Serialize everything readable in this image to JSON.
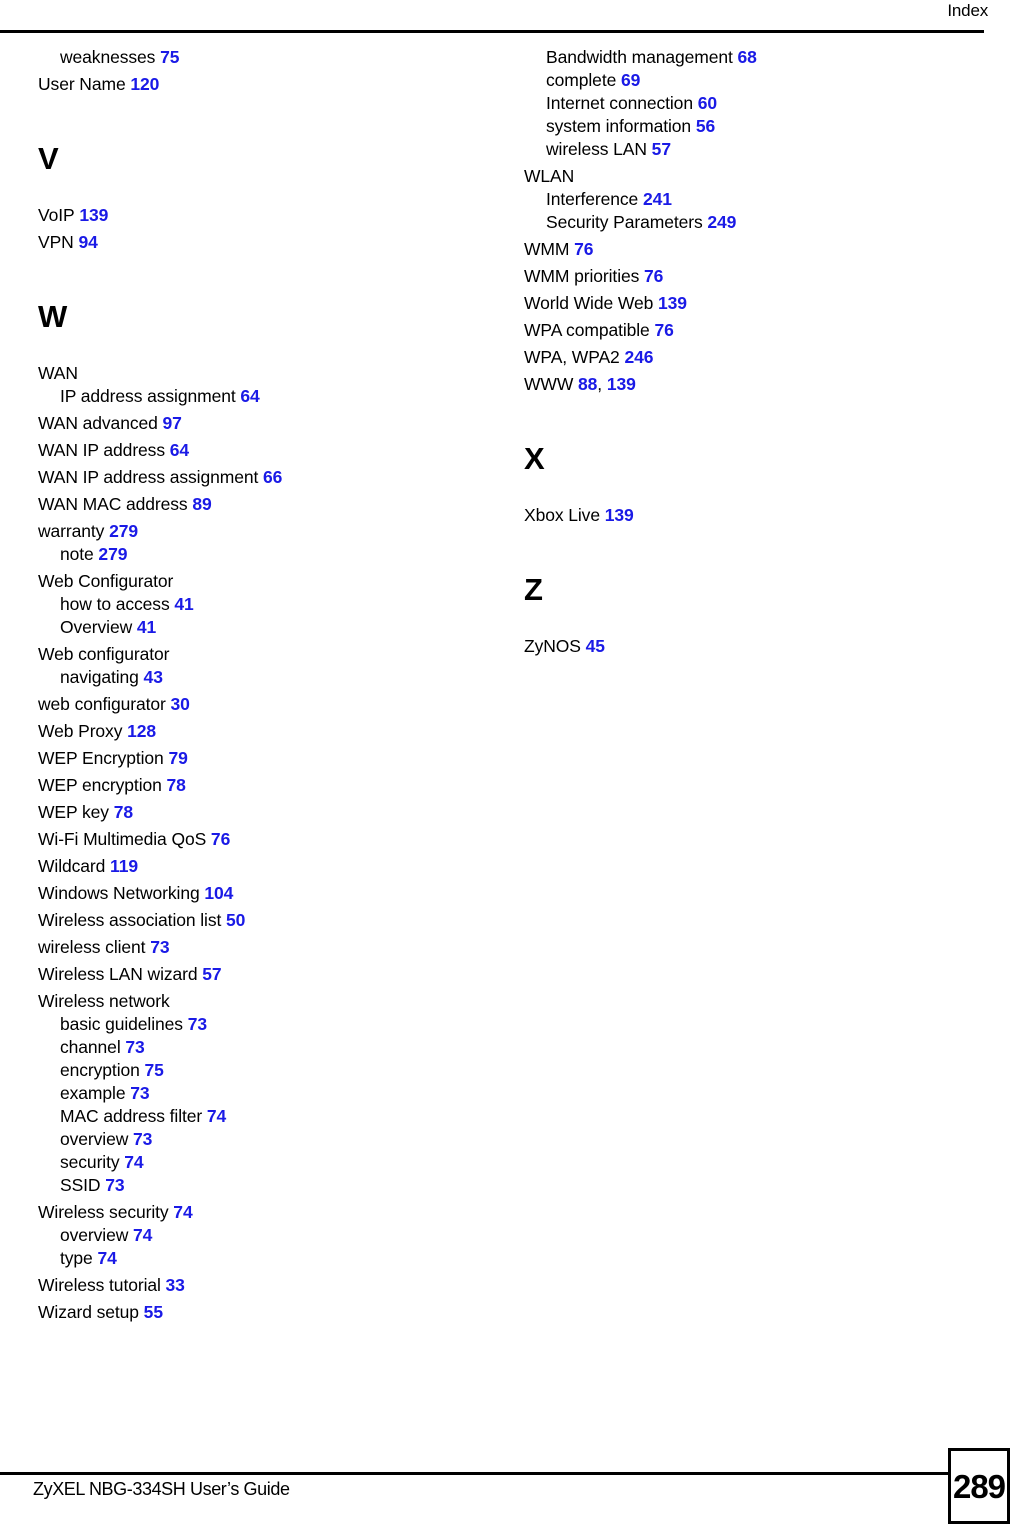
{
  "header": {
    "title": "Index"
  },
  "footer": {
    "guide_title": "ZyXEL NBG-334SH User’s Guide",
    "page_number": "289"
  },
  "colors": {
    "page_ref": "#1a1ae6",
    "text": "#000000",
    "background": "#ffffff"
  },
  "columns": {
    "left": {
      "continued_entries": [
        {
          "level": 1,
          "term": "weaknesses",
          "pages": [
            "75"
          ]
        },
        {
          "level": 0,
          "term": "User Name",
          "pages": [
            "120"
          ]
        }
      ],
      "sections": [
        {
          "letter": "V",
          "entries": [
            {
              "level": 0,
              "term": "VoIP",
              "pages": [
                "139"
              ]
            },
            {
              "level": 0,
              "term": "VPN",
              "pages": [
                "94"
              ]
            }
          ]
        },
        {
          "letter": "W",
          "entries": [
            {
              "level": 0,
              "term": "WAN",
              "pages": []
            },
            {
              "level": 1,
              "term": "IP address assignment",
              "pages": [
                "64"
              ]
            },
            {
              "level": 0,
              "term": "WAN advanced",
              "pages": [
                "97"
              ]
            },
            {
              "level": 0,
              "term": "WAN IP address",
              "pages": [
                "64"
              ]
            },
            {
              "level": 0,
              "term": "WAN IP address assignment",
              "pages": [
                "66"
              ]
            },
            {
              "level": 0,
              "term": "WAN MAC address",
              "pages": [
                "89"
              ]
            },
            {
              "level": 0,
              "term": "warranty",
              "pages": [
                "279"
              ]
            },
            {
              "level": 1,
              "term": "note",
              "pages": [
                "279"
              ]
            },
            {
              "level": 0,
              "term": "Web Configurator",
              "pages": []
            },
            {
              "level": 1,
              "term": "how to access",
              "pages": [
                "41"
              ]
            },
            {
              "level": 1,
              "term": "Overview",
              "pages": [
                "41"
              ]
            },
            {
              "level": 0,
              "term": "Web configurator",
              "pages": []
            },
            {
              "level": 1,
              "term": "navigating",
              "pages": [
                "43"
              ]
            },
            {
              "level": 0,
              "term": "web configurator",
              "pages": [
                "30"
              ]
            },
            {
              "level": 0,
              "term": "Web Proxy",
              "pages": [
                "128"
              ]
            },
            {
              "level": 0,
              "term": "WEP Encryption",
              "pages": [
                "79"
              ]
            },
            {
              "level": 0,
              "term": "WEP encryption",
              "pages": [
                "78"
              ]
            },
            {
              "level": 0,
              "term": "WEP key",
              "pages": [
                "78"
              ]
            },
            {
              "level": 0,
              "term": "Wi-Fi Multimedia QoS",
              "pages": [
                "76"
              ]
            },
            {
              "level": 0,
              "term": "Wildcard",
              "pages": [
                "119"
              ]
            },
            {
              "level": 0,
              "term": "Windows Networking",
              "pages": [
                "104"
              ]
            },
            {
              "level": 0,
              "term": "Wireless association list",
              "pages": [
                "50"
              ]
            },
            {
              "level": 0,
              "term": "wireless client",
              "pages": [
                "73"
              ]
            },
            {
              "level": 0,
              "term": "Wireless LAN wizard",
              "pages": [
                "57"
              ]
            },
            {
              "level": 0,
              "term": "Wireless network",
              "pages": []
            },
            {
              "level": 1,
              "term": "basic guidelines",
              "pages": [
                "73"
              ]
            },
            {
              "level": 1,
              "term": "channel",
              "pages": [
                "73"
              ]
            },
            {
              "level": 1,
              "term": "encryption",
              "pages": [
                "75"
              ]
            },
            {
              "level": 1,
              "term": "example",
              "pages": [
                "73"
              ]
            },
            {
              "level": 1,
              "term": "MAC address filter",
              "pages": [
                "74"
              ]
            },
            {
              "level": 1,
              "term": "overview",
              "pages": [
                "73"
              ]
            },
            {
              "level": 1,
              "term": "security",
              "pages": [
                "74"
              ]
            },
            {
              "level": 1,
              "term": "SSID",
              "pages": [
                "73"
              ]
            },
            {
              "level": 0,
              "term": "Wireless security",
              "pages": [
                "74"
              ]
            },
            {
              "level": 1,
              "term": "overview",
              "pages": [
                "74"
              ]
            },
            {
              "level": 1,
              "term": "type",
              "pages": [
                "74"
              ]
            },
            {
              "level": 0,
              "term": "Wireless tutorial",
              "pages": [
                "33"
              ]
            },
            {
              "level": 0,
              "term": "Wizard setup",
              "pages": [
                "55"
              ]
            }
          ]
        }
      ]
    },
    "right": {
      "continued_entries": [
        {
          "level": 1,
          "term": "Bandwidth management",
          "pages": [
            "68"
          ]
        },
        {
          "level": 1,
          "term": "complete",
          "pages": [
            "69"
          ]
        },
        {
          "level": 1,
          "term": "Internet connection",
          "pages": [
            "60"
          ]
        },
        {
          "level": 1,
          "term": "system information",
          "pages": [
            "56"
          ]
        },
        {
          "level": 1,
          "term": "wireless LAN",
          "pages": [
            "57"
          ]
        },
        {
          "level": 0,
          "term": "WLAN",
          "pages": []
        },
        {
          "level": 1,
          "term": "Interference",
          "pages": [
            "241"
          ]
        },
        {
          "level": 1,
          "term": "Security Parameters",
          "pages": [
            "249"
          ]
        },
        {
          "level": 0,
          "term": "WMM",
          "pages": [
            "76"
          ]
        },
        {
          "level": 0,
          "term": "WMM priorities",
          "pages": [
            "76"
          ]
        },
        {
          "level": 0,
          "term": "World Wide Web",
          "pages": [
            "139"
          ]
        },
        {
          "level": 0,
          "term": "WPA compatible",
          "pages": [
            "76"
          ]
        },
        {
          "level": 0,
          "term": "WPA, WPA2",
          "pages": [
            "246"
          ]
        },
        {
          "level": 0,
          "term": "WWW",
          "pages": [
            "88",
            "139"
          ]
        }
      ],
      "sections": [
        {
          "letter": "X",
          "entries": [
            {
              "level": 0,
              "term": "Xbox Live",
              "pages": [
                "139"
              ]
            }
          ]
        },
        {
          "letter": "Z",
          "entries": [
            {
              "level": 0,
              "term": "ZyNOS",
              "pages": [
                "45"
              ]
            }
          ]
        }
      ]
    }
  }
}
